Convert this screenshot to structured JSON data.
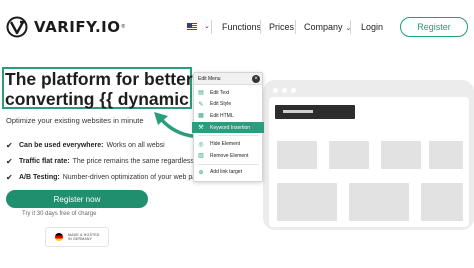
{
  "header": {
    "logo_text": "VARIFY.IO",
    "logo_reg": "®",
    "nav": {
      "functions": "Functions",
      "prices": "Prices",
      "company": "Company",
      "login": "Login",
      "register": "Register"
    }
  },
  "hero": {
    "headline_line1": "The platform for better",
    "headline_line2": "converting {{ dynamic }}",
    "subline": "Optimize your existing websites in minute",
    "features": [
      {
        "bold": "Can be used everywhere:",
        "text": "Works on all websi"
      },
      {
        "bold": "Traffic flat rate:",
        "text": "The price remains the same regardless of"
      },
      {
        "bold": "A/B Testing:",
        "text": "Number-driven optimization of your web pag"
      }
    ],
    "cta_label": "Register now",
    "trial_text": "Try it 30 days free of charge",
    "badge_text": "MADE & HOSTED IN GERMANY"
  },
  "context_menu": {
    "title": "Edit Menu",
    "close": "×",
    "items": [
      {
        "icon": "text-icon",
        "glyph": "▤",
        "label": "Edit Text"
      },
      {
        "icon": "style-icon",
        "glyph": "✎",
        "label": "Edit Style"
      },
      {
        "icon": "html-icon",
        "glyph": "▦",
        "label": "Edit HTML"
      },
      {
        "icon": "keyword-icon",
        "glyph": "⚒",
        "label": "Keyword Insertion"
      },
      {
        "icon": "eye-off-icon",
        "glyph": "◎",
        "label": "Hide Element"
      },
      {
        "icon": "trash-icon",
        "glyph": "▥",
        "label": "Remove Element"
      },
      {
        "icon": "link-icon",
        "glyph": "⊕",
        "label": "Add link target"
      }
    ]
  },
  "colors": {
    "brand_green": "#1f9e77",
    "cta_green": "#1f8f6e",
    "menu_active": "#2a9d7c"
  }
}
